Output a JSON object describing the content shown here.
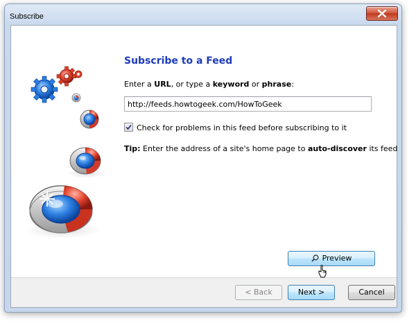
{
  "window": {
    "title": "Subscribe"
  },
  "page": {
    "heading": "Subscribe to a Feed",
    "instruction_parts": [
      "Enter a ",
      "URL",
      ", or type a ",
      "keyword",
      " or ",
      "phrase",
      ":"
    ],
    "url_value": "http://feeds.howtogeek.com/HowToGeek",
    "check_problems": {
      "label": "Check for problems in this feed before subscribing to it",
      "checked": true
    },
    "tip_parts": [
      "Tip:",
      " Enter the address of a site's home page to ",
      "auto-discover",
      " its feed"
    ]
  },
  "buttons": {
    "preview": "Preview",
    "back": "< Back",
    "next": "Next >",
    "cancel": "Cancel"
  },
  "icons": {
    "close": "close-icon",
    "preview": "magnifier-icon",
    "cursor": "mouse-pointer-icon",
    "illustration": "rss-gears-illustration"
  },
  "colors": {
    "heading": "#1e3bb8",
    "accent_red": "#d33a2a",
    "accent_blue": "#1a62c8"
  }
}
